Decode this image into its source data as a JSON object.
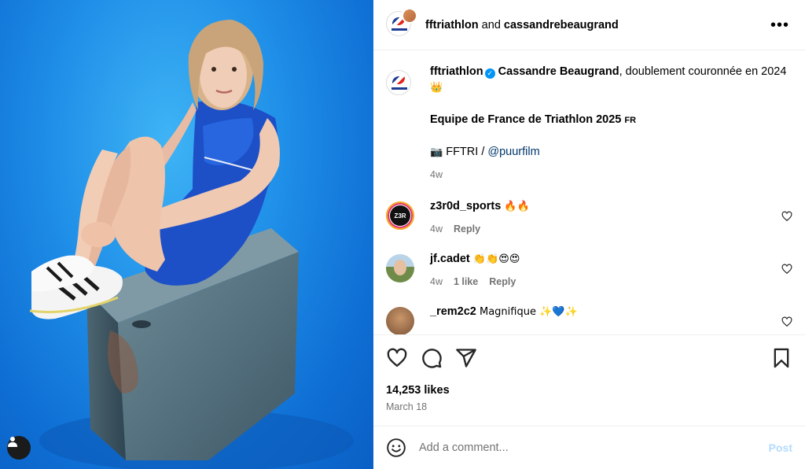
{
  "header": {
    "user1": "fftriathlon",
    "joiner": " and ",
    "user2": "cassandrebeaugrand",
    "more": "•••"
  },
  "caption": {
    "username": "fftriathlon",
    "highlight": "Cassandre Beaugrand",
    "text": ", doublement couronnée en 2024 ",
    "crown": "👑",
    "line2": "Equipe de France de Triathlon 2025",
    "flag": "FR",
    "credit_icon": "📷",
    "credit_text": " FFTRI / ",
    "credit_link": "@puurfilm",
    "time": "4w"
  },
  "comments": [
    {
      "username": "z3r0d_sports",
      "text": " 🔥🔥",
      "time": "4w",
      "likes": "",
      "reply": "Reply"
    },
    {
      "username": "jf.cadet",
      "text": " 👏👏😍😍",
      "time": "4w",
      "likes": "1 like",
      "reply": "Reply"
    },
    {
      "username": "_rem2c2",
      "text": " Magnifique ✨💙✨",
      "time": "",
      "likes": "",
      "reply": ""
    }
  ],
  "stats": {
    "likes": "14,253 likes",
    "date": "March 18"
  },
  "composer": {
    "placeholder": "Add a comment...",
    "post": "Post"
  },
  "icons": [
    "heart-icon",
    "comment-icon",
    "share-icon",
    "bookmark-icon",
    "smiley-icon",
    "user-tag-icon",
    "more-icon"
  ]
}
